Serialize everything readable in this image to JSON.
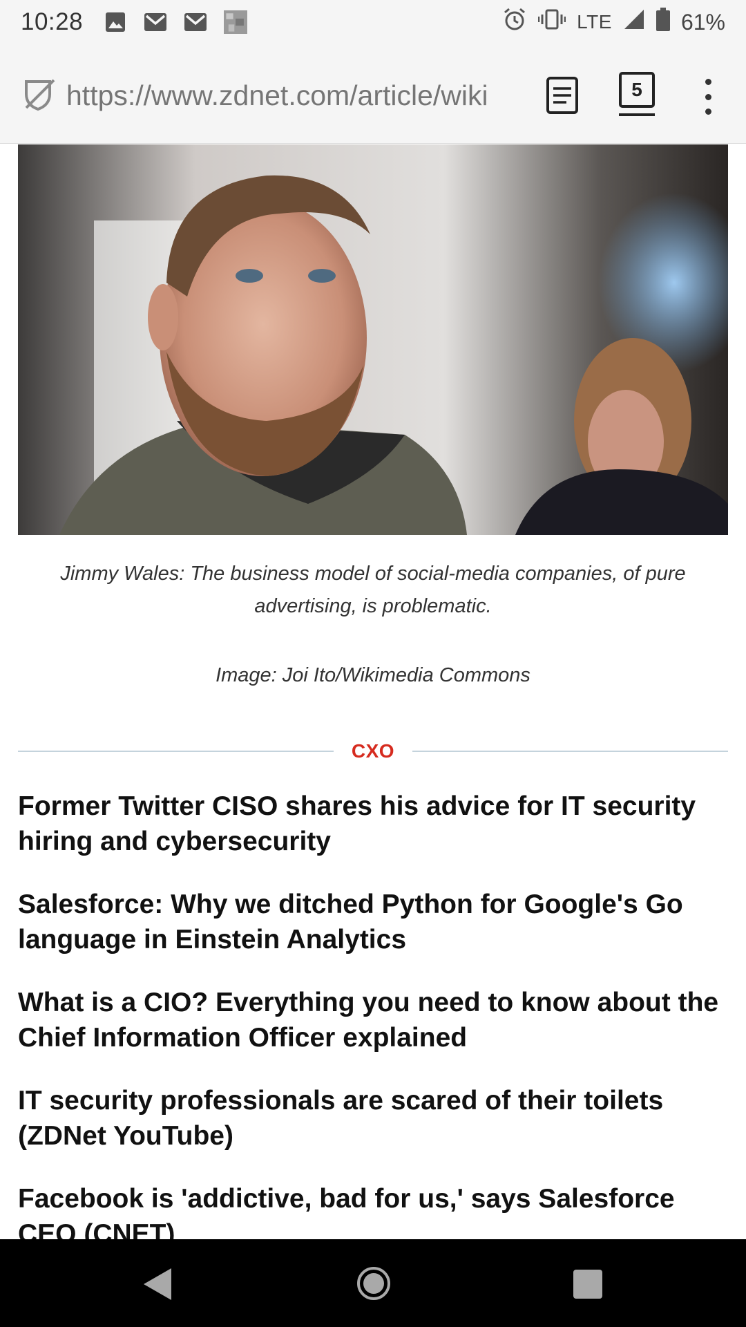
{
  "status_bar": {
    "time": "10:28",
    "left_icons": [
      "image-icon",
      "gmail-icon",
      "gmail-icon",
      "app-thumbnail-icon"
    ],
    "network": "LTE",
    "battery": "61%"
  },
  "browser": {
    "url": "https://www.zdnet.com/article/wiki",
    "tab_count": "5"
  },
  "article": {
    "caption": "Jimmy Wales: The business model of social-media companies, of pure advertising, is problematic.",
    "credit": "Image: Joi Ito/Wikimedia Commons"
  },
  "related": {
    "section_label": "CXO",
    "items": [
      "Former Twitter CISO shares his advice for IT security hiring and cybersecurity",
      "Salesforce: Why we ditched Python for Google's Go language in Einstein Analytics",
      "What is a CIO? Everything you need to know about the Chief Information Officer explained",
      "IT security professionals are scared of their toilets (ZDNet YouTube)",
      "Facebook is 'addictive, bad for us,' says Salesforce CEO (CNET)"
    ]
  },
  "colors": {
    "section_label": "#d62b1f",
    "divider": "#c4d3dc",
    "nav_bar": "#000000"
  }
}
